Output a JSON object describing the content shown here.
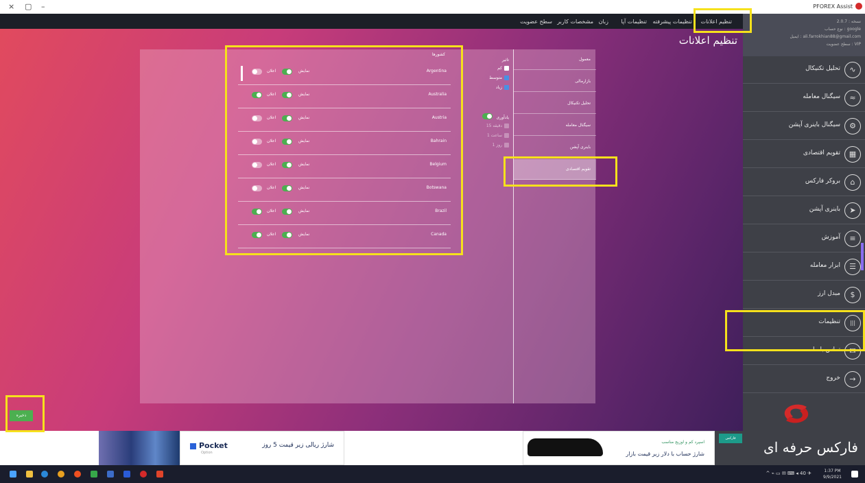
{
  "window": {
    "close": "×",
    "restore": "▢",
    "minimize": "–",
    "title": "PFOREX Assist"
  },
  "top_menu": [
    "تنظیم اعلانات",
    "تنظیمات پیشرفته",
    "تنظیمات آپا",
    "زبان",
    "مشخصات کاربر",
    "سطح عضویت"
  ],
  "account": {
    "line1": "نسخه : 2.0.7",
    "line2": "نوع حساب : google",
    "line3": "ایمیل : ali.farrokhian88@gmail.com",
    "line4": "سطح عضویت : VIP"
  },
  "page_title": "تنظیم اعلانات",
  "categories": [
    "معمول",
    "بازارمالی",
    "تحلیل تکنیکال",
    "سیگنال معامله",
    "باینری آپشن",
    "تقویم اقتصادی"
  ],
  "active_category": 5,
  "priority": {
    "heading": "تاثیر",
    "items": [
      {
        "label": "کم",
        "checked": false
      },
      {
        "label": "متوسط",
        "checked": true
      },
      {
        "label": "زیاد",
        "checked": true
      }
    ],
    "reminder_label": "یادآوری",
    "reminder_on": true,
    "reminder_items": [
      "15 دقیقه",
      "1 ساعت",
      "1 روز"
    ]
  },
  "countries_header": "کشورها",
  "countries": [
    {
      "name": "Argentina",
      "notify_label": "نمایش",
      "alert_label": "اعلان",
      "notify": true,
      "alert": false
    },
    {
      "name": "Australia",
      "notify_label": "نمایش",
      "alert_label": "اعلان",
      "notify": true,
      "alert": true
    },
    {
      "name": "Austria",
      "notify_label": "نمایش",
      "alert_label": "اعلان",
      "notify": true,
      "alert": false
    },
    {
      "name": "Bahrain",
      "notify_label": "نمایش",
      "alert_label": "اعلان",
      "notify": true,
      "alert": false
    },
    {
      "name": "Belgium",
      "notify_label": "نمایش",
      "alert_label": "اعلان",
      "notify": true,
      "alert": false
    },
    {
      "name": "Botswana",
      "notify_label": "نمایش",
      "alert_label": "اعلان",
      "notify": true,
      "alert": false
    },
    {
      "name": "Brazil",
      "notify_label": "نمایش",
      "alert_label": "اعلان",
      "notify": true,
      "alert": true
    },
    {
      "name": "Canada",
      "notify_label": "نمایش",
      "alert_label": "اعلان",
      "notify": true,
      "alert": true
    }
  ],
  "sidebar": [
    {
      "label": "تحلیل تکنیکال",
      "icon": "chart-line-icon",
      "glyph": "∿"
    },
    {
      "label": "سیگنال معامله",
      "icon": "signal-icon",
      "glyph": "≈"
    },
    {
      "label": "سیگنال باینری آپشن",
      "icon": "gear-icon",
      "glyph": "⚙"
    },
    {
      "label": "تقویم اقتصادی",
      "icon": "calendar-icon",
      "glyph": "▦"
    },
    {
      "label": "بروکر فارکس",
      "icon": "broker-icon",
      "glyph": "⌂"
    },
    {
      "label": "باینری آپشن",
      "icon": "cursor-icon",
      "glyph": "➤"
    },
    {
      "label": "آموزش",
      "icon": "education-icon",
      "glyph": "≡"
    },
    {
      "label": "ابزار معامله",
      "icon": "tools-icon",
      "glyph": "☰"
    },
    {
      "label": "مبدل ارز",
      "icon": "currency-icon",
      "glyph": "$"
    },
    {
      "label": "تنظیمات",
      "icon": "settings-icon",
      "glyph": "|||"
    },
    {
      "label": "تماس با ما",
      "icon": "mail-icon",
      "glyph": "✉"
    },
    {
      "label": "خروج",
      "icon": "exit-icon",
      "glyph": "→"
    }
  ],
  "save_label": "ذخیره",
  "ads": {
    "pocket_brand": "Pocket",
    "pocket_sub": "Option",
    "pocket_text": "شارژ ریالی زیر قیمت 5 روز",
    "right_line1": "اسپرد کم و اوزیج مناسب",
    "right_line2": "شارژ حساب با دلار زیر قیمت بازار",
    "brand": "فارکس حرفه ای",
    "brand_badge": "فارکس"
  },
  "taskbar": {
    "time": "1:37 PM",
    "date": "9/9/2021",
    "tray": "^  ⌁  ▭  ✉  ⌨  ◂ 40  ✈"
  },
  "colors": {
    "accent_green": "#4caf50",
    "highlight": "#f6e11c",
    "sidebar_bg": "#3e4047"
  }
}
